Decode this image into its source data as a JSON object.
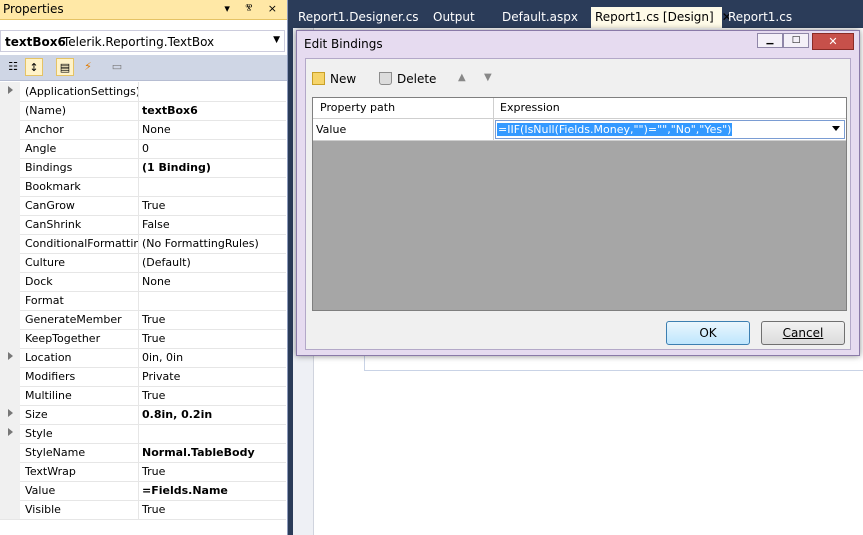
{
  "properties_panel": {
    "title": "Properties",
    "title_buttons": "▾ ⰺ ×",
    "object_name": "textBox6",
    "object_type": "Telerik.Reporting.TextBox",
    "rows": [
      {
        "key": "(ApplicationSettings)",
        "value": "",
        "expandable": true,
        "bold": false
      },
      {
        "key": "(Name)",
        "value": "textBox6",
        "expandable": false,
        "bold": true
      },
      {
        "key": "Anchor",
        "value": "None",
        "expandable": false,
        "bold": false
      },
      {
        "key": "Angle",
        "value": "0",
        "expandable": false,
        "bold": false
      },
      {
        "key": "Bindings",
        "value": "(1 Binding)",
        "expandable": false,
        "bold": true
      },
      {
        "key": "Bookmark",
        "value": "",
        "expandable": false,
        "bold": false
      },
      {
        "key": "CanGrow",
        "value": "True",
        "expandable": false,
        "bold": false
      },
      {
        "key": "CanShrink",
        "value": "False",
        "expandable": false,
        "bold": false
      },
      {
        "key": "ConditionalFormatting",
        "value": "(No FormattingRules)",
        "expandable": false,
        "bold": false
      },
      {
        "key": "Culture",
        "value": "(Default)",
        "expandable": false,
        "bold": false
      },
      {
        "key": "Dock",
        "value": "None",
        "expandable": false,
        "bold": false
      },
      {
        "key": "Format",
        "value": "",
        "expandable": false,
        "bold": false
      },
      {
        "key": "GenerateMember",
        "value": "True",
        "expandable": false,
        "bold": false
      },
      {
        "key": "KeepTogether",
        "value": "True",
        "expandable": false,
        "bold": false
      },
      {
        "key": "Location",
        "value": "0in, 0in",
        "expandable": true,
        "bold": false
      },
      {
        "key": "Modifiers",
        "value": "Private",
        "expandable": false,
        "bold": false
      },
      {
        "key": "Multiline",
        "value": "True",
        "expandable": false,
        "bold": false
      },
      {
        "key": "Size",
        "value": "0.8in, 0.2in",
        "expandable": true,
        "bold": true
      },
      {
        "key": "Style",
        "value": "",
        "expandable": true,
        "bold": false
      },
      {
        "key": "StyleName",
        "value": "Normal.TableBody",
        "expandable": false,
        "bold": true
      },
      {
        "key": "TextWrap",
        "value": "True",
        "expandable": false,
        "bold": false
      },
      {
        "key": "Value",
        "value": "=Fields.Name",
        "expandable": false,
        "bold": true
      },
      {
        "key": "Visible",
        "value": "True",
        "expandable": false,
        "bold": false
      }
    ]
  },
  "tabs": [
    {
      "label": "Report1.Designer.cs",
      "active": false
    },
    {
      "label": "Output",
      "active": false
    },
    {
      "label": "Default.aspx",
      "active": false
    },
    {
      "label": "Report1.cs [Design]",
      "active": true
    },
    {
      "label": "Report1.cs",
      "active": false
    }
  ],
  "dialog": {
    "title": "Edit Bindings",
    "toolbar": {
      "new_label": "New",
      "delete_label": "Delete"
    },
    "columns": {
      "property_path": "Property path",
      "expression": "Expression"
    },
    "binding": {
      "property_path": "Value",
      "expression": "=IIF(IsNull(Fields.Money,\"\")=\"\",\"No\",\"Yes\")"
    },
    "ok_label": "OK",
    "cancel_label": "Cancel"
  },
  "colors": {
    "panel_title": "#ffe8a6",
    "dialog_frame": "#e6dbf0",
    "selection": "#3399ff",
    "grid_empty": "#a6a6a6"
  }
}
